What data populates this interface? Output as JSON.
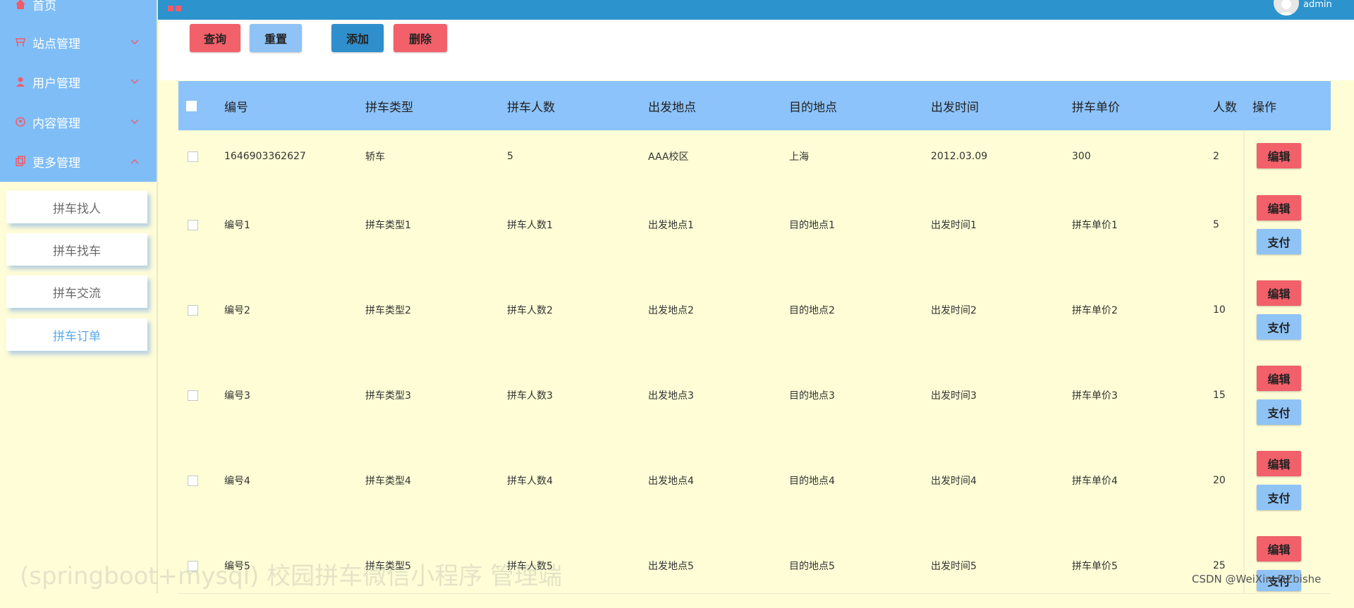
{
  "sidebar": {
    "home_label": "首页",
    "items": [
      {
        "label": "站点管理"
      },
      {
        "label": "用户管理"
      },
      {
        "label": "内容管理"
      },
      {
        "label": "更多管理"
      }
    ],
    "sub_items": [
      {
        "label": "拼车找人"
      },
      {
        "label": "拼车找车"
      },
      {
        "label": "拼车交流"
      },
      {
        "label": "拼车订单"
      }
    ]
  },
  "header": {
    "user": "admin"
  },
  "toolbar": {
    "query": "查询",
    "reset": "重置",
    "add": "添加",
    "delete": "删除"
  },
  "table": {
    "columns": [
      "编号",
      "拼车类型",
      "拼车人数",
      "出发地点",
      "目的地点",
      "出发时间",
      "拼车单价",
      "人数",
      "操作"
    ],
    "rows": [
      {
        "id": "1646903362627",
        "type": "轿车",
        "seats": "5",
        "from": "AAA校区",
        "to": "上海",
        "time": "2012.03.09",
        "price": "300",
        "people": "2"
      },
      {
        "id": "编号1",
        "type": "拼车类型1",
        "seats": "拼车人数1",
        "from": "出发地点1",
        "to": "目的地点1",
        "time": "出发时间1",
        "price": "拼车单价1",
        "people": "5"
      },
      {
        "id": "编号2",
        "type": "拼车类型2",
        "seats": "拼车人数2",
        "from": "出发地点2",
        "to": "目的地点2",
        "time": "出发时间2",
        "price": "拼车单价2",
        "people": "10"
      },
      {
        "id": "编号3",
        "type": "拼车类型3",
        "seats": "拼车人数3",
        "from": "出发地点3",
        "to": "目的地点3",
        "time": "出发时间3",
        "price": "拼车单价3",
        "people": "15"
      },
      {
        "id": "编号4",
        "type": "拼车类型4",
        "seats": "拼车人数4",
        "from": "出发地点4",
        "to": "目的地点4",
        "time": "出发时间4",
        "price": "拼车单价4",
        "people": "20"
      },
      {
        "id": "编号5",
        "type": "拼车类型5",
        "seats": "拼车人数5",
        "from": "出发地点5",
        "to": "目的地点5",
        "time": "出发时间5",
        "price": "拼车单价5",
        "people": "25"
      }
    ],
    "edit_label": "编辑",
    "pay_label": "支付"
  },
  "overlay": {
    "watermark": "CSDN @WeiXin_DZbishe",
    "caption": "(springboot+mysql) 校园拼车微信小程序 管理端"
  },
  "colors": {
    "sidebar_top": "#7fbdf7",
    "header": "#2d93cd",
    "table_head": "#8cc3fa",
    "row_bg": "#fefdd6",
    "btn_red": "#f2606a",
    "btn_light_blue": "#8fc3f6",
    "btn_blue": "#2f8fcc"
  },
  "icons": [
    "home-icon",
    "store-icon",
    "user-icon",
    "content-icon",
    "more-icon",
    "chevron-down-icon",
    "chevron-up-icon",
    "grid-icon",
    "avatar-icon",
    "checkbox-icon"
  ]
}
